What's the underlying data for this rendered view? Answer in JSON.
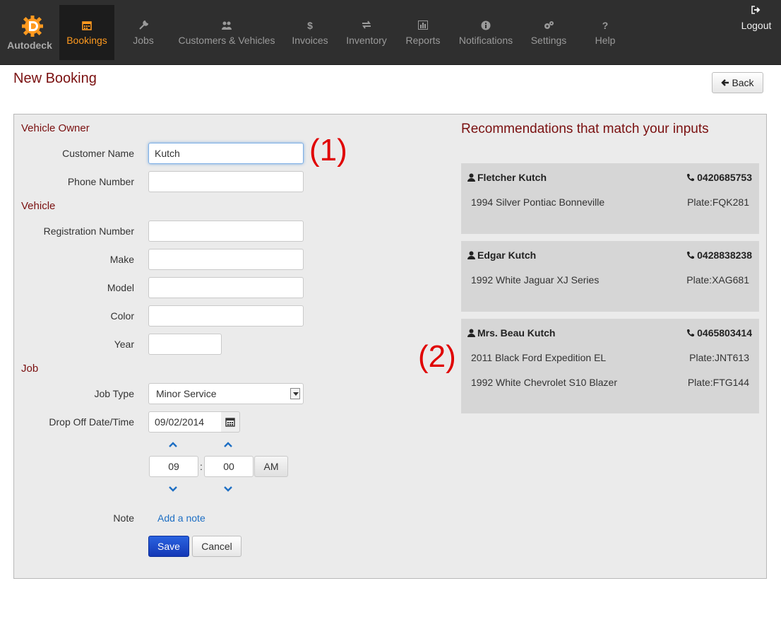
{
  "nav": {
    "brand": "Autodeck",
    "items": [
      {
        "label": "Bookings",
        "icon": "calendar-icon"
      },
      {
        "label": "Jobs",
        "icon": "wrench-icon"
      },
      {
        "label": "Customers & Vehicles",
        "icon": "users-icon"
      },
      {
        "label": "Invoices",
        "icon": "dollar-icon"
      },
      {
        "label": "Inventory",
        "icon": "exchange-icon"
      },
      {
        "label": "Reports",
        "icon": "bar-chart-icon"
      },
      {
        "label": "Notifications",
        "icon": "info-icon"
      },
      {
        "label": "Settings",
        "icon": "cogs-icon"
      },
      {
        "label": "Help",
        "icon": "question-icon"
      }
    ],
    "active": "Bookings",
    "logout": "Logout"
  },
  "page": {
    "title": "New Booking",
    "back_label": "Back"
  },
  "form": {
    "owner_section": "Vehicle Owner",
    "customer_name_label": "Customer Name",
    "customer_name_value": "Kutch",
    "phone_label": "Phone Number",
    "phone_value": "",
    "vehicle_section": "Vehicle",
    "registration_label": "Registration Number",
    "registration_value": "",
    "make_label": "Make",
    "make_value": "",
    "model_label": "Model",
    "model_value": "",
    "color_label": "Color",
    "color_value": "",
    "year_label": "Year",
    "year_value": "",
    "job_section": "Job",
    "job_type_label": "Job Type",
    "job_type_value": "Minor Service",
    "dropoff_label": "Drop Off Date/Time",
    "dropoff_date": "09/02/2014",
    "hour": "09",
    "minute": "00",
    "ampm": "AM",
    "note_label": "Note",
    "add_note": "Add a note",
    "save_label": "Save",
    "cancel_label": "Cancel"
  },
  "recommendations": {
    "heading": "Recommendations that match your inputs",
    "cards": [
      {
        "owner": "Fletcher Kutch",
        "phone": "0420685753",
        "vehicles": [
          {
            "name": "1994 Silver Pontiac Bonneville",
            "plate": "Plate:FQK281"
          }
        ]
      },
      {
        "owner": "Edgar Kutch",
        "phone": "0428838238",
        "vehicles": [
          {
            "name": "1992 White Jaguar XJ Series",
            "plate": "Plate:XAG681"
          }
        ]
      },
      {
        "owner": "Mrs. Beau Kutch",
        "phone": "0465803414",
        "vehicles": [
          {
            "name": "2011 Black Ford Expedition EL",
            "plate": "Plate:JNT613"
          },
          {
            "name": "1992 White Chevrolet S10 Blazer",
            "plate": "Plate:FTG144"
          }
        ]
      }
    ]
  },
  "annotations": [
    "(1)",
    "(2)"
  ],
  "colors": {
    "nav_bg": "#2f2f2f",
    "nav_active": "#ff9a1f",
    "heading": "#7a1010",
    "card_bg": "#d6d6d6",
    "primary": "#1438b6",
    "annotation": "#e00000"
  }
}
